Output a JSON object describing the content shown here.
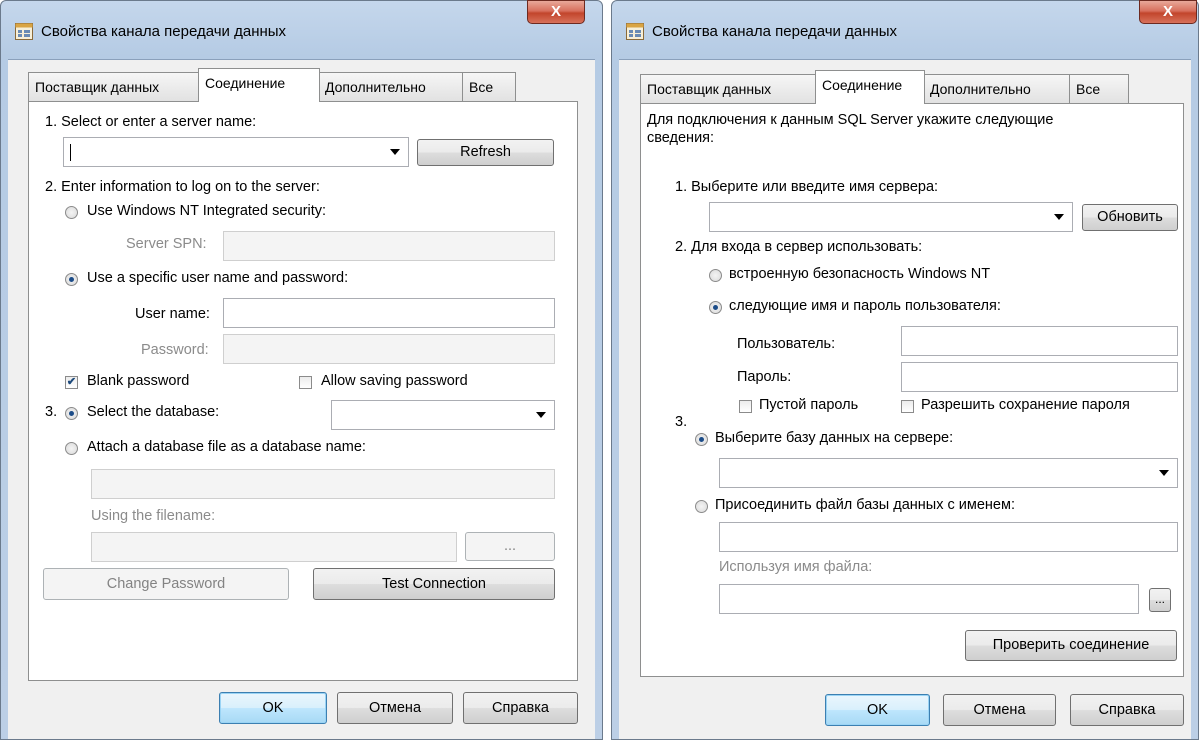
{
  "left_dialog": {
    "title": "Свойства канала передачи данных",
    "close_label": "X",
    "tabs": [
      "Поставщик данных",
      "Соединение",
      "Дополнительно",
      "Все"
    ],
    "step1_label": "1. Select or enter a server name:",
    "server_value": "",
    "refresh_label": "Refresh",
    "step2_label": "2. Enter information to log on to the server:",
    "nt_security_label": "Use Windows NT Integrated security:",
    "server_spn_label": "Server SPN:",
    "specific_user_label": "Use a specific user name and password:",
    "user_name_label": "User name:",
    "password_label": "Password:",
    "blank_password_label": "Blank password",
    "allow_saving_label": "Allow saving password",
    "step3_label": "3.",
    "select_db_label": "Select the database:",
    "attach_db_label": "Attach a database file as a database name:",
    "using_filename_label": "Using the filename:",
    "browse_label": "...",
    "change_password_label": "Change Password",
    "test_connection_label": "Test Connection",
    "ok_label": "OK",
    "cancel_label": "Отмена",
    "help_label": "Справка"
  },
  "right_dialog": {
    "title": "Свойства канала передачи данных",
    "close_label": "X",
    "tabs": [
      "Поставщик данных",
      "Соединение",
      "Дополнительно",
      "Все"
    ],
    "intro_line1": "Для подключения к данным SQL Server укажите следующие",
    "intro_line2": "сведения:",
    "step1_label": "1. Выберите или введите имя сервера:",
    "refresh_label": "Обновить",
    "step2_label": "2. Для входа в сервер использовать:",
    "nt_security_label": "встроенную безопасность Windows NT",
    "specific_user_label": "следующие имя и пароль пользователя:",
    "user_label": "Пользователь:",
    "password_label": "Пароль:",
    "blank_password_label": "Пустой пароль",
    "allow_saving_label": "Разрешить сохранение пароля",
    "step3_label": "3.",
    "select_db_label": "Выберите базу данных на сервере:",
    "attach_db_label": "Присоединить файл базы данных с именем:",
    "using_filename_label": "Используя имя файла:",
    "browse_label": "...",
    "test_connection_label": "Проверить соединение",
    "ok_label": "OK",
    "cancel_label": "Отмена",
    "help_label": "Справка"
  }
}
